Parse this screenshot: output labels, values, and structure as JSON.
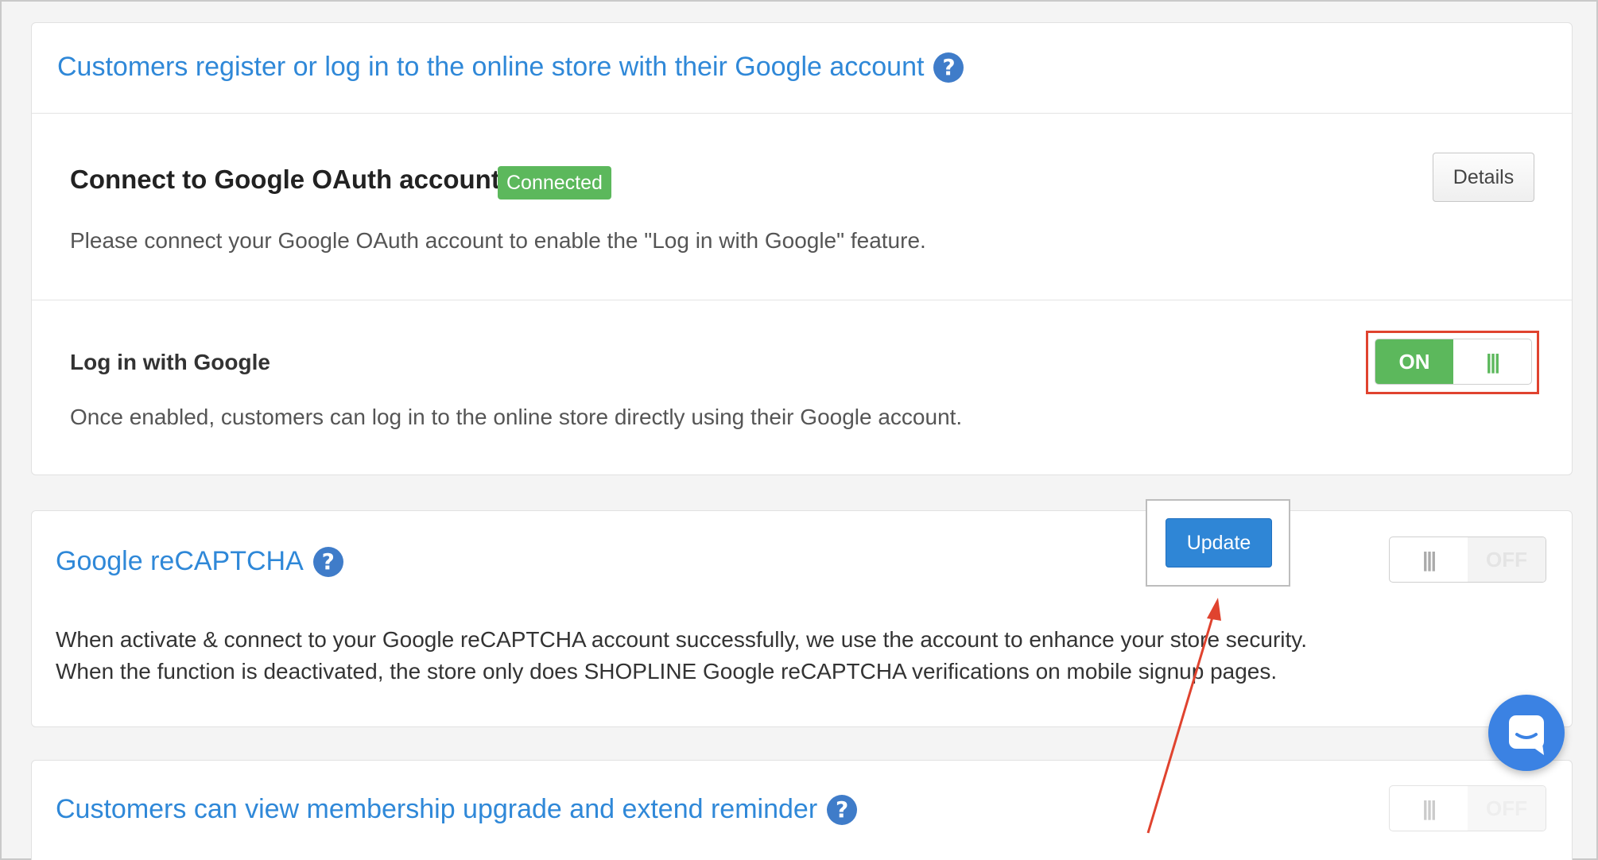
{
  "google_login_section": {
    "title": "Customers register or log in to the online store with their Google account",
    "help_icon": "?",
    "oauth": {
      "title": "Connect to Google OAuth account",
      "status_badge": "Connected",
      "details_button": "Details",
      "description": "Please connect your Google OAuth account to enable the \"Log in with Google\" feature."
    },
    "login_with_google": {
      "title": "Log in with Google",
      "description": "Once enabled, customers can log in to the online store directly using their Google account.",
      "toggle": {
        "state": "on",
        "on_label": "ON",
        "grip": "|||"
      }
    }
  },
  "recaptcha_section": {
    "title": "Google reCAPTCHA",
    "help_icon": "?",
    "update_button": "Update",
    "description_line1": "When activate & connect to your Google reCAPTCHA account successfully, we use the account to enhance your store security.",
    "description_line2": "When the function is deactivated, the store only does SHOPLINE Google reCAPTCHA verifications on mobile signup pages.",
    "toggle": {
      "state": "off",
      "off_label": "OFF",
      "grip": "|||"
    }
  },
  "membership_section": {
    "title": "Customers can view membership upgrade and extend reminder",
    "help_icon": "?",
    "toggle": {
      "state": "off",
      "off_label": "OFF",
      "grip": "|||"
    }
  },
  "annotation": {
    "highlight_color": "#e0432f",
    "arrow_color": "#e0432f"
  },
  "chat_widget": {
    "icon": "chat-icon",
    "color": "#3b82e3"
  }
}
